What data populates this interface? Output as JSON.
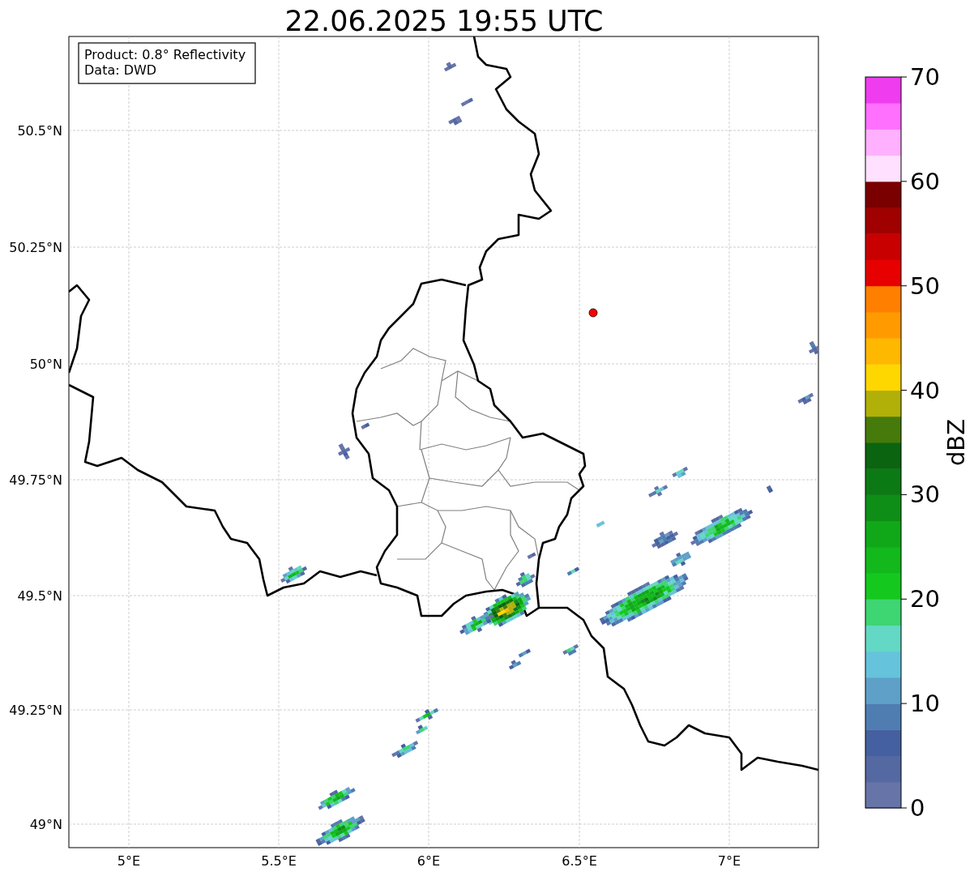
{
  "title": "22.06.2025 19:55 UTC",
  "info_box": [
    "Product: 0.8° Reflectivity",
    "Data: DWD"
  ],
  "map": {
    "lat_labels": [
      "50.5°N",
      "50.25°N",
      "50°N",
      "49.75°N",
      "49.5°N",
      "49.25°N",
      "49°N"
    ],
    "lon_labels": [
      "5°E",
      "5.5°E",
      "6°E",
      "6.5°E",
      "7°E"
    ]
  },
  "colorbar": {
    "label": "dBZ",
    "tick_labels": [
      "70",
      "60",
      "50",
      "40",
      "30",
      "20",
      "10",
      "0"
    ],
    "colors": [
      {
        "color": "#6674a8"
      },
      {
        "color": "#5468a2"
      },
      {
        "color": "#4560a0"
      },
      {
        "color": "#4f7db2"
      },
      {
        "color": "#5ea0c8"
      },
      {
        "color": "#66c3dc"
      },
      {
        "color": "#63d8c4"
      },
      {
        "color": "#3dd672"
      },
      {
        "color": "#14c81e"
      },
      {
        "color": "#12b81c"
      },
      {
        "color": "#10a818"
      },
      {
        "color": "#0e8e16"
      },
      {
        "color": "#0c7a14"
      },
      {
        "color": "#0a6410"
      },
      {
        "color": "#467a0a"
      },
      {
        "color": "#b0b008"
      },
      {
        "color": "#ffd700"
      },
      {
        "color": "#ffb800"
      },
      {
        "color": "#ff9a00"
      },
      {
        "color": "#ff8000"
      },
      {
        "color": "#e60000"
      },
      {
        "color": "#c80000"
      },
      {
        "color": "#a00000"
      },
      {
        "color": "#7a0000"
      },
      {
        "color": "#ffe0ff"
      },
      {
        "color": "#ffb0ff"
      },
      {
        "color": "#ff70ff"
      },
      {
        "color": "#ee3cee"
      }
    ]
  }
}
